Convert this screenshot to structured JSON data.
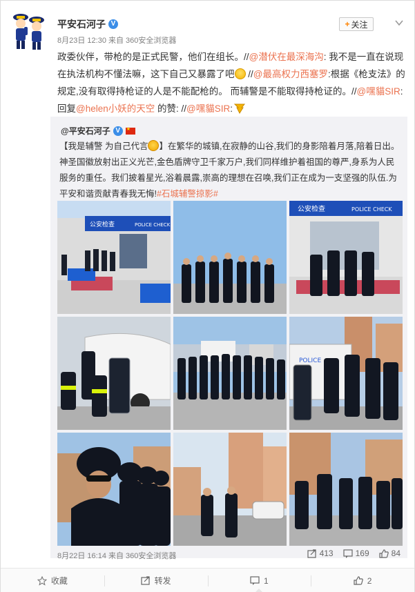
{
  "post": {
    "author": "平安石河子",
    "verified_mark": "V",
    "follow_button": "关注",
    "meta": "8月23日 12:30 来自 360安全浏览器",
    "text": {
      "p1": "政委伙伴，带枪的是正式民警，他们在组长。//",
      "m1": "@潜伏在最深海沟",
      "p2": ": 我不是一直在说现在执法机构不懂法嘛，这下自己又暴露了吧",
      "p3": " //",
      "m2": "@最高权力西塞罗",
      "p4": ":根据《枪支法》的规定,没有取得持枪证的人是不能配枪的。 而辅警是不能取得持枪证的。//",
      "m3": "@嘿貓SIR",
      "p5": ": 回复",
      "m4": "@helen小妖的天空",
      "p6": " 的赞: //",
      "m5": "@嘿貓SIR",
      "p7": ":"
    }
  },
  "repost": {
    "author": "@平安石河子",
    "verified_mark": "V",
    "text": {
      "t1": "【我是辅警 为自己代言",
      "t2": "】在繁华的城镇,在寂静的山谷,我们的身影陪着月落,陪着日出。神圣国徽放射出正义光芒,金色盾牌守卫千家万户,我们同样维护着祖国的尊严,身系为人民服务的重任。我们披着星光,浴着晨露,崇高的理想在召唤,我们正在成为一支坚强的队伍.为平安和谐贡献青春我无悔!",
      "topic": "#石城辅警掠影#"
    },
    "sign_text": {
      "station": "公安检查",
      "police_check": "POLICE CHECK",
      "police": "POLICE"
    },
    "meta": "8月22日 16:14 来自 360安全浏览器",
    "stats": {
      "reposts": "413",
      "comments": "169",
      "likes": "84"
    }
  },
  "actions": {
    "favorite": "收藏",
    "repost": "转发",
    "comment": "1",
    "like": "2"
  },
  "colors": {
    "mention": "#eb7350",
    "verified": "#3b8ee8",
    "follow_plus": "#ff8200"
  }
}
